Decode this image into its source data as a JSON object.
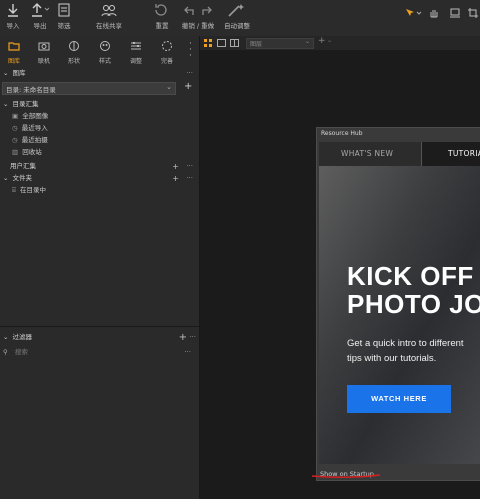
{
  "toolbar": {
    "buttons": [
      {
        "label": "导入"
      },
      {
        "label": "导出"
      },
      {
        "label": "筛选"
      },
      {
        "label": "在线共享"
      },
      {
        "label": "重置"
      },
      {
        "label": "撤销 / 重做"
      },
      {
        "label": "自动调整"
      }
    ]
  },
  "modules": [
    {
      "label": "图库"
    },
    {
      "label": "联机"
    },
    {
      "label": "形状"
    },
    {
      "label": "样式"
    },
    {
      "label": "调整"
    },
    {
      "label": "完善"
    }
  ],
  "library": {
    "title": "图库",
    "catalog": "目录: 未命名目录",
    "section_all": "目录汇集",
    "items": [
      "全部图像",
      "最近导入",
      "最近拍摄",
      "回收站"
    ],
    "user_collections": "用户汇集",
    "folders": "文件夹",
    "folder_item": "在目录中"
  },
  "filter": {
    "title": "过滤器",
    "search_placeholder": "搜索"
  },
  "center": {
    "view_select": "图层",
    "plus": "+"
  },
  "hub": {
    "title": "Resource Hub",
    "tabs": [
      "WHAT'S NEW",
      "TUTORIA"
    ],
    "headline_1": "KICK OFF",
    "headline_2": "PHOTO JO",
    "intro_1": "Get a quick intro to different",
    "intro_2": "tips with our tutorials.",
    "cta": "WATCH HERE",
    "startup": "Show on Startup"
  },
  "colors": {
    "accent": "#f0a020",
    "cta": "#1a73e8",
    "annotation": "#d62020"
  }
}
